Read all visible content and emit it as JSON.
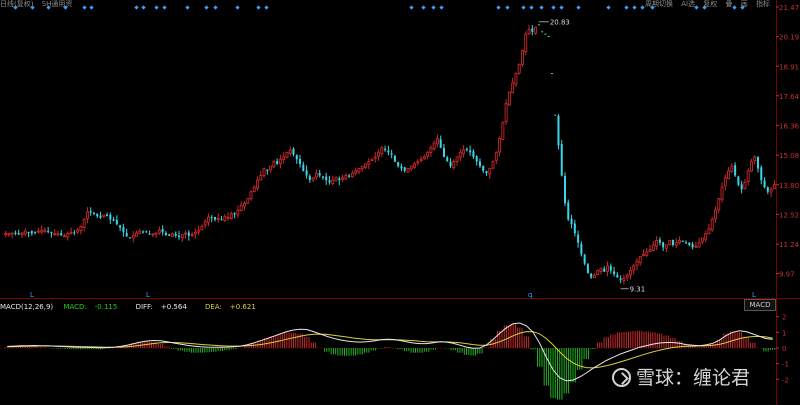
{
  "colors": {
    "background": "#000000",
    "up": "#c82828",
    "down": "#3ad5e6",
    "grid": "#7a0000",
    "axis_text": "#c83030",
    "diff_line": "#e8e8e8",
    "dea_line": "#d8d040",
    "macd_up": "#c82828",
    "macd_down": "#1fb31f"
  },
  "header": {
    "left_items": [
      "日线(复权)",
      "SH通用资"
    ],
    "right_items": [
      "周期切换",
      "AI选",
      "复权",
      "叠",
      "画",
      "指标"
    ]
  },
  "price_axis": {
    "ticks": [
      "21.47",
      "20.19",
      "18.91",
      "17.64",
      "16.36",
      "15.08",
      "13.80",
      "12.52",
      "11.24",
      "9.97"
    ]
  },
  "annotations": {
    "high_label": "20.83",
    "low_label": "9.31"
  },
  "macd_axis": {
    "ticks": [
      "2",
      "1",
      "0",
      "-1",
      "-2"
    ]
  },
  "macd_legend": {
    "name": "MACD(12,26,9)",
    "macd_label": "MACD:",
    "macd_value": "-0.115",
    "diff_label": "DIFF:",
    "diff_value": "+0.564",
    "dea_label": "DEA:",
    "dea_value": "+0.621"
  },
  "macd_tab_label": "MACD",
  "bottom_markers": [
    "L",
    "L",
    "q",
    "L"
  ],
  "watermark": {
    "text": "雪球：缠论君",
    "icon": "snowball-logo-icon"
  },
  "chart_data": {
    "type": "candlestick",
    "ylim": [
      9.0,
      21.6
    ],
    "close_series": [
      11.7,
      11.68,
      11.72,
      11.68,
      11.65,
      11.72,
      11.8,
      11.75,
      11.7,
      11.75,
      11.8,
      11.82,
      11.85,
      11.78,
      11.72,
      11.7,
      11.68,
      11.62,
      11.6,
      11.7,
      11.75,
      11.72,
      11.85,
      12.0,
      12.3,
      12.62,
      12.6,
      12.55,
      12.45,
      12.38,
      12.5,
      12.45,
      12.3,
      12.25,
      12.1,
      11.95,
      11.75,
      11.58,
      11.5,
      11.62,
      11.72,
      11.8,
      11.76,
      11.75,
      11.66,
      11.68,
      11.72,
      11.84,
      11.75,
      11.62,
      11.6,
      11.68,
      11.6,
      11.54,
      11.65,
      11.72,
      11.6,
      11.66,
      11.75,
      11.82,
      12.0,
      12.2,
      12.4,
      12.38,
      12.3,
      12.35,
      12.3,
      12.42,
      12.4,
      12.55,
      12.52,
      12.7,
      12.9,
      13.0,
      13.2,
      13.5,
      13.7,
      14.0,
      14.2,
      14.5,
      14.4,
      14.6,
      14.8,
      14.7,
      14.9,
      15.0,
      15.2,
      15.3,
      15.1,
      14.9,
      14.7,
      14.4,
      14.2,
      14.0,
      14.1,
      14.3,
      14.2,
      14.1,
      14.0,
      13.9,
      14.0,
      14.1,
      14.0,
      14.1,
      14.2,
      14.15,
      14.3,
      14.4,
      14.5,
      14.6,
      14.7,
      14.8,
      14.9,
      15.0,
      15.2,
      15.4,
      15.3,
      15.2,
      15.1,
      14.8,
      14.6,
      14.5,
      14.4,
      14.5,
      14.6,
      14.7,
      14.8,
      14.9,
      15.0,
      15.2,
      15.4,
      15.6,
      15.8,
      15.4,
      15.0,
      14.8,
      14.6,
      14.8,
      15.0,
      15.2,
      15.3,
      15.3,
      15.2,
      15.0,
      14.8,
      14.6,
      14.4,
      14.3,
      14.5,
      14.8,
      15.2,
      15.8,
      16.5,
      17.3,
      17.8,
      18.2,
      18.6,
      19.0,
      19.6,
      20.3,
      20.5,
      20.4,
      20.6,
      20.7,
      20.4,
      20.3,
      20.2,
      18.6,
      16.8,
      15.5,
      14.2,
      13.0,
      12.3,
      12.1,
      11.7,
      11.3,
      10.8,
      10.4,
      10.0,
      9.8,
      9.9,
      10.1,
      10.2,
      10.05,
      10.3,
      10.1,
      9.95,
      9.8,
      9.7,
      9.75,
      9.9,
      10.1,
      10.3,
      10.5,
      10.7,
      10.8,
      10.9,
      11.0,
      11.2,
      11.4,
      11.3,
      11.1,
      11.2,
      11.4,
      11.2,
      11.3,
      11.4,
      11.35,
      11.3,
      11.2,
      11.1,
      11.15,
      11.3,
      11.5,
      11.7,
      11.9,
      12.3,
      12.7,
      13.2,
      13.7,
      14.1,
      14.4,
      14.6,
      14.2,
      13.8,
      13.6,
      13.9,
      14.4,
      14.8,
      15.0,
      14.5,
      14.0,
      13.7,
      13.5,
      13.6,
      13.8
    ],
    "high_label_value": 20.83,
    "low_label_value": 9.31,
    "macd": {
      "ylim": [
        -2.3,
        2.3
      ],
      "dif": [
        0.1,
        0.12,
        0.14,
        0.15,
        0.16,
        0.15,
        0.14,
        0.12,
        0.1,
        0.08,
        0.06,
        0.05,
        0.04,
        0.03,
        0.02,
        0.03,
        0.05,
        0.1,
        0.18,
        0.28,
        0.38,
        0.45,
        0.48,
        0.46,
        0.4,
        0.32,
        0.25,
        0.18,
        0.12,
        0.08,
        0.06,
        0.05,
        0.05,
        0.06,
        0.08,
        0.12,
        0.2,
        0.32,
        0.46,
        0.6,
        0.75,
        0.9,
        1.05,
        1.15,
        1.2,
        1.18,
        1.05,
        0.9,
        0.75,
        0.62,
        0.52,
        0.45,
        0.4,
        0.38,
        0.4,
        0.45,
        0.52,
        0.56,
        0.54,
        0.48,
        0.4,
        0.32,
        0.28,
        0.28,
        0.34,
        0.4,
        0.38,
        0.3,
        0.18,
        0.06,
        -0.02,
        0.0,
        0.2,
        0.55,
        0.95,
        1.3,
        1.55,
        1.6,
        1.42,
        1.0,
        0.3,
        -0.6,
        -1.4,
        -1.9,
        -2.1,
        -2.05,
        -1.85,
        -1.6,
        -1.3,
        -1.05,
        -0.8,
        -0.6,
        -0.4,
        -0.25,
        -0.1,
        0.05,
        0.15,
        0.25,
        0.32,
        0.35,
        0.35,
        0.3,
        0.22,
        0.18,
        0.15,
        0.2,
        0.3,
        0.5,
        0.8,
        1.0,
        1.1,
        1.05,
        0.9,
        0.75,
        0.6,
        0.56
      ],
      "dea": [
        0.08,
        0.09,
        0.1,
        0.11,
        0.12,
        0.13,
        0.13,
        0.13,
        0.12,
        0.11,
        0.1,
        0.09,
        0.08,
        0.07,
        0.06,
        0.05,
        0.05,
        0.06,
        0.08,
        0.12,
        0.17,
        0.23,
        0.29,
        0.33,
        0.35,
        0.35,
        0.33,
        0.3,
        0.27,
        0.23,
        0.2,
        0.17,
        0.15,
        0.13,
        0.12,
        0.12,
        0.14,
        0.17,
        0.22,
        0.29,
        0.37,
        0.46,
        0.56,
        0.66,
        0.75,
        0.83,
        0.88,
        0.89,
        0.87,
        0.82,
        0.76,
        0.7,
        0.64,
        0.59,
        0.55,
        0.53,
        0.53,
        0.53,
        0.53,
        0.52,
        0.5,
        0.47,
        0.43,
        0.4,
        0.39,
        0.39,
        0.39,
        0.37,
        0.33,
        0.28,
        0.22,
        0.18,
        0.18,
        0.26,
        0.4,
        0.58,
        0.78,
        0.95,
        1.05,
        1.04,
        0.9,
        0.6,
        0.2,
        -0.25,
        -0.65,
        -0.95,
        -1.15,
        -1.25,
        -1.27,
        -1.22,
        -1.14,
        -1.03,
        -0.9,
        -0.77,
        -0.64,
        -0.5,
        -0.37,
        -0.25,
        -0.14,
        -0.05,
        0.03,
        0.08,
        0.11,
        0.12,
        0.13,
        0.14,
        0.17,
        0.23,
        0.34,
        0.47,
        0.6,
        0.69,
        0.73,
        0.74,
        0.71,
        0.62
      ]
    }
  }
}
